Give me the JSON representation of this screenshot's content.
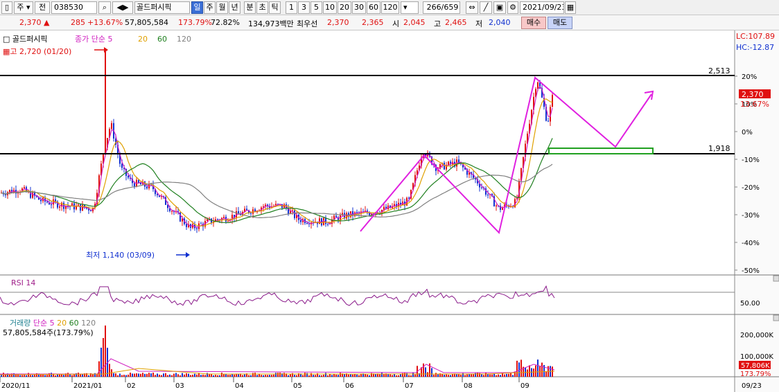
{
  "toolbar": {
    "market_sel": "주",
    "type_btn": "전",
    "code": "038530",
    "name": "골드퍼시픽",
    "periods": [
      "일",
      "주",
      "월",
      "년",
      "분",
      "초",
      "틱"
    ],
    "active_period": "일",
    "minutes": [
      "1",
      "3",
      "5",
      "10",
      "20",
      "30",
      "60",
      "120"
    ],
    "count": "266/659",
    "date": "2021/09/23"
  },
  "quote": {
    "price": "2,370",
    "change": "285",
    "change_pct": "+13.67%",
    "volume": "57,805,584",
    "vol_ratio": "173.79%",
    "turnover": "72.82%",
    "amount": "134,973백만",
    "best_label": "최우선",
    "best_ask": "2,370",
    "best_bid": "2,365",
    "open_label": "시",
    "open": "2,045",
    "high_label": "고",
    "high": "2,465",
    "low_label": "저",
    "low": "2,040",
    "buy_label": "매수",
    "sell_label": "매도"
  },
  "colors": {
    "up": "#e01010",
    "down": "#1030d0",
    "ma5": "#d020c0",
    "ma20": "#e0a000",
    "ma60": "#208020",
    "ma120": "#808080",
    "pattern": "#e020e0",
    "box": "#20a020"
  },
  "chart_data": {
    "type": "candlestick",
    "title": "골드퍼시픽",
    "legend": {
      "price_label": "종가",
      "ma_label": "단순",
      "periods": [
        "5",
        "20",
        "60",
        "120"
      ]
    },
    "annotations": {
      "high": "고 2,720 (01/20)",
      "low": "최저 1,140 (03/09)",
      "resistance_value": 2513,
      "resistance_label": "2,513",
      "support_value": 1918,
      "support_label": "1,918",
      "lc_label": "LC:107.89",
      "hc_label": "HC:-12.87",
      "current_price_label": "2,370",
      "current_pct_label": "13.67%"
    },
    "y_axis": {
      "ticks": [
        "20%",
        "10%",
        "0%",
        "-10%",
        "-20%",
        "-30%",
        "-40%",
        "-50%"
      ]
    },
    "x_axis": {
      "ticks": [
        "2020/11",
        "2021/01",
        "02",
        "03",
        "04",
        "05",
        "06",
        "07",
        "08",
        "09"
      ],
      "current": "09/23"
    },
    "rsi": {
      "label": "RSI 14",
      "level_label": "50.00"
    },
    "volume": {
      "label": "거래량",
      "ma_label": "단순",
      "periods": [
        "5",
        "20",
        "60",
        "120"
      ],
      "last_label": "57,805,584주(173.79%)",
      "ticks": [
        "200,000K",
        "100,000K"
      ],
      "current_label": "57,806K",
      "current_pct": "173.79%"
    }
  }
}
